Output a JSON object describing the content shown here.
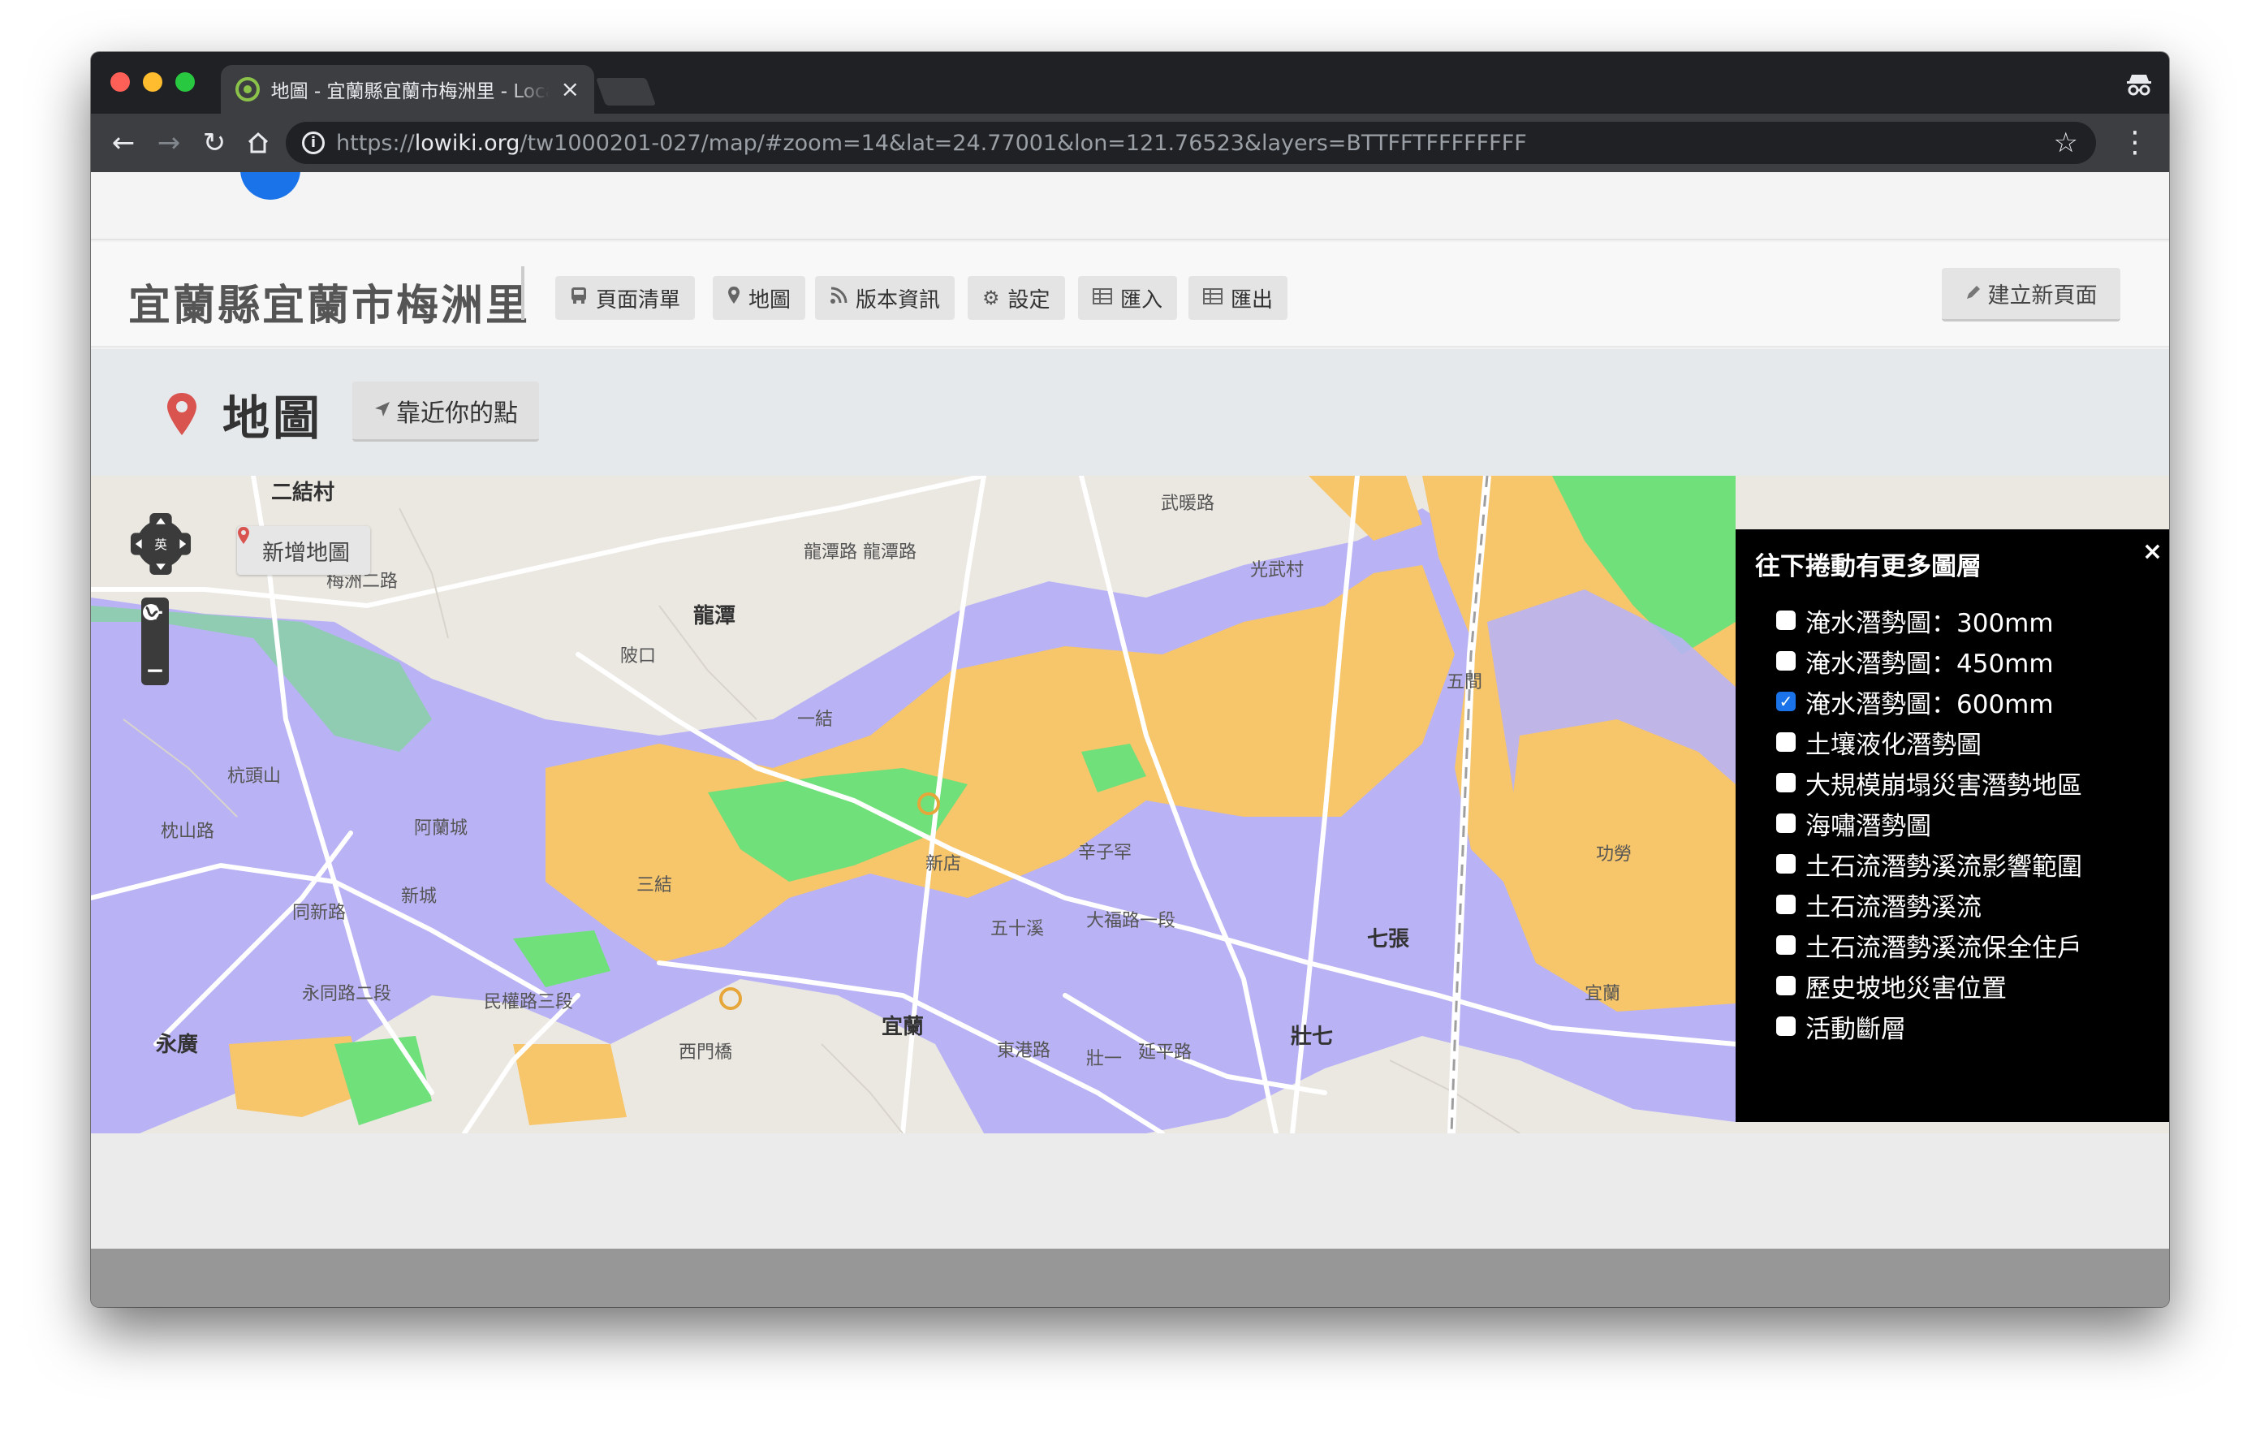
{
  "browser": {
    "tab_title": "地圖 - 宜蘭縣宜蘭市梅洲里 - LocalWiki",
    "tab_close": "×",
    "url_scheme": "https://",
    "url_host": "lowiki.org",
    "url_path": "/tw1000201-027/map/#zoom=14&lat=24.77001&lon=121.76523&layers=BTTFFTFFFFFFFF",
    "info_glyph": "i"
  },
  "site": {
    "title": "宜蘭縣宜蘭市梅洲里",
    "nav": [
      {
        "label": "頁面清單",
        "icon": "bus-icon"
      },
      {
        "label": "地圖",
        "icon": "map-marker-icon"
      },
      {
        "label": "版本資訊",
        "icon": "rss-icon"
      },
      {
        "label": "設定",
        "icon": "gear-icon"
      },
      {
        "label": "匯入",
        "icon": "table-icon"
      },
      {
        "label": "匯出",
        "icon": "table-icon"
      }
    ],
    "create_page": "建立新頁面"
  },
  "page": {
    "heading": "地圖",
    "near_button": "靠近你的點"
  },
  "map": {
    "add_map": "新增地圖",
    "zoom_in": "+",
    "zoom_out": "−",
    "colors": {
      "base": "#ebe8e2",
      "orange": "#f7c56a",
      "purple": "#b9b3f5",
      "green": "#6fe07a",
      "road": "#ffffff"
    },
    "labels": [
      "二結村",
      "龍潭",
      "陂口",
      "一結",
      "杭頭山",
      "阿蘭城",
      "新城",
      "三結",
      "新店",
      "辛子罕",
      "光武村",
      "五間",
      "七張",
      "功勞",
      "宜蘭",
      "壯七",
      "壯一",
      "永廣",
      "梅洲二路",
      "武暖路",
      "龍潭路 龍潭路",
      "大福路一段",
      "五十溪",
      "東港路",
      "延平路",
      "同新路",
      "枕山路",
      "永同路二段",
      "民權路三段",
      "西門橋",
      "宜蘭"
    ]
  },
  "layers": {
    "title": "往下捲動有更多圖層",
    "close": "×",
    "items": [
      {
        "label": "淹水潛勢圖：300mm",
        "checked": false
      },
      {
        "label": "淹水潛勢圖：450mm",
        "checked": false
      },
      {
        "label": "淹水潛勢圖：600mm",
        "checked": true
      },
      {
        "label": "土壤液化潛勢圖",
        "checked": false
      },
      {
        "label": "大規模崩塌災害潛勢地區",
        "checked": false
      },
      {
        "label": "海嘯潛勢圖",
        "checked": false
      },
      {
        "label": "土石流潛勢溪流影響範圍",
        "checked": false
      },
      {
        "label": "土石流潛勢溪流",
        "checked": false
      },
      {
        "label": "土石流潛勢溪流保全住戶",
        "checked": false
      },
      {
        "label": "歷史坡地災害位置",
        "checked": false
      },
      {
        "label": "活動斷層",
        "checked": false
      }
    ]
  }
}
